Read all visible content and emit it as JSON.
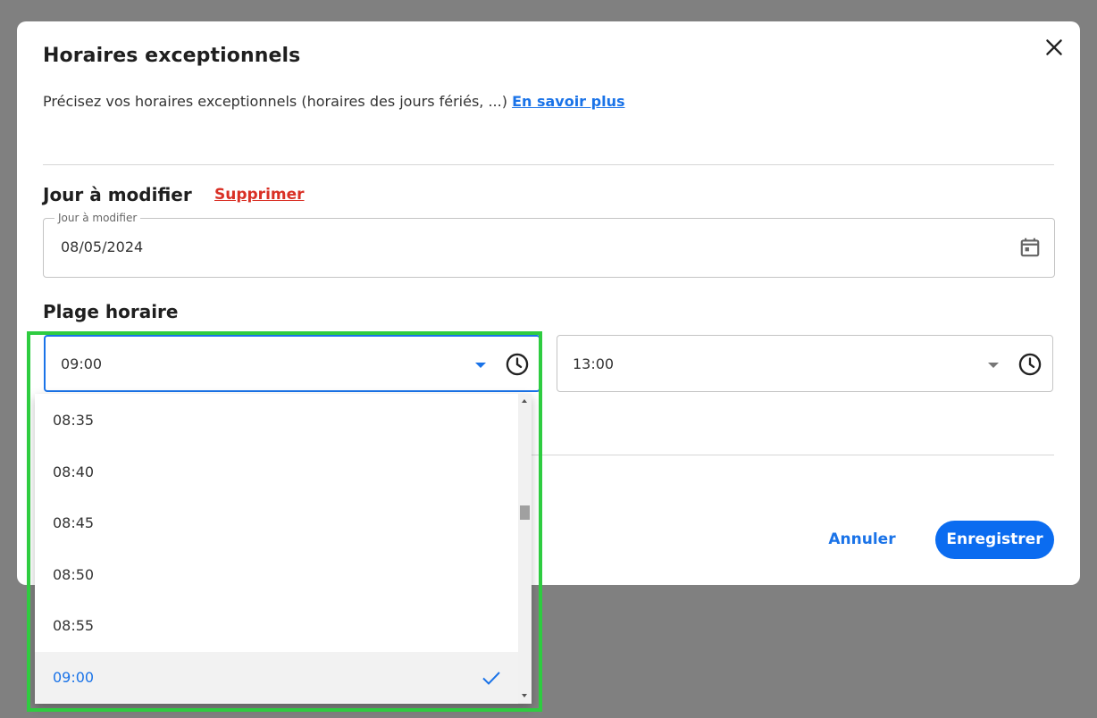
{
  "modal": {
    "title": "Horaires exceptionnels",
    "subtitle": "Précisez vos horaires exceptionnels (horaires des jours fériés, ...)",
    "learn_more": "En savoir plus"
  },
  "day_section": {
    "title": "Jour à modifier",
    "delete_label": "Supprimer",
    "field_label": "Jour à modifier",
    "date_value": "08/05/2024"
  },
  "time_section": {
    "title": "Plage horaire",
    "start_value": "09:00",
    "end_value": "13:00"
  },
  "dropdown": {
    "options": [
      "08:35",
      "08:40",
      "08:45",
      "08:50",
      "08:55",
      "09:00"
    ],
    "selected": "09:00"
  },
  "footer": {
    "cancel_label": "Annuler",
    "save_label": "Enregistrer"
  },
  "colors": {
    "accent": "#1a73e8",
    "primary_button": "#0b6cf0",
    "danger": "#d93025",
    "highlight": "#2ecc40",
    "backdrop": "#808080"
  },
  "icons": [
    "close-icon",
    "calendar-icon",
    "clock-icon",
    "chevron-down-icon",
    "check-icon"
  ]
}
